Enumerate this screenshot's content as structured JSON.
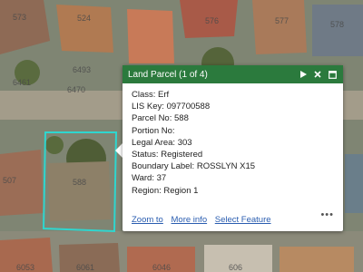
{
  "map": {
    "parcel_labels": [
      "573",
      "524",
      "576",
      "577",
      "578",
      "6493",
      "6470",
      "6461",
      "507",
      "588",
      "6053",
      "6061",
      "6046",
      "606"
    ]
  },
  "popup": {
    "title": "Land Parcel (1 of 4)",
    "fields": [
      {
        "label": "Class:",
        "value": "Erf"
      },
      {
        "label": "LIS Key:",
        "value": "097700588"
      },
      {
        "label": "Parcel No:",
        "value": "588"
      },
      {
        "label": "Portion No:",
        "value": ""
      },
      {
        "label": "Legal Area:",
        "value": "303"
      },
      {
        "label": "Status:",
        "value": "Registered"
      },
      {
        "label": "Boundary Label:",
        "value": "ROSSLYN X15"
      },
      {
        "label": "Ward:",
        "value": "37"
      },
      {
        "label": "Region:",
        "value": "Region 1"
      }
    ],
    "actions": {
      "zoom": "Zoom to",
      "more_info": "More info",
      "select": "Select Feature"
    },
    "more_menu": "•••",
    "icons": {
      "next": "play-icon",
      "close": "close-icon",
      "dock": "dock-icon"
    }
  },
  "colors": {
    "header": "#2b7a3d",
    "highlight": "#2fd6cf",
    "link": "#2a5db0"
  }
}
